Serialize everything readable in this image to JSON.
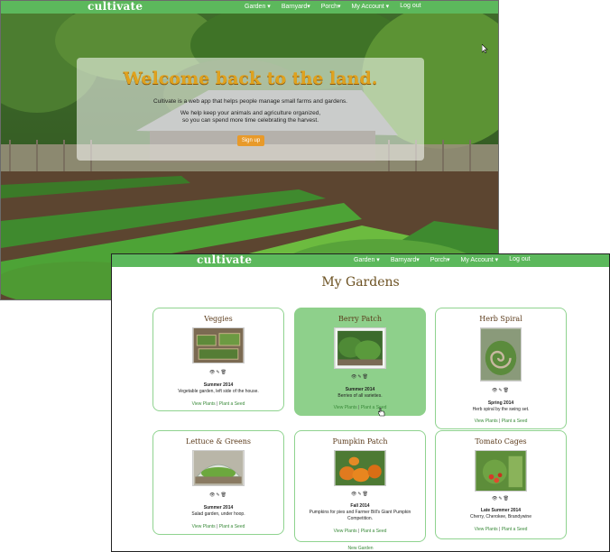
{
  "back": {
    "brand": "cultivate",
    "nav": [
      "Garden ▾",
      "Barnyard▾",
      "Porch▾",
      "My Account ▾",
      "Log out"
    ],
    "hero": {
      "title": "Welcome back to the land.",
      "line1": "Cultivate is a web app that helps people manage small farms and gardens.",
      "line2": "We help keep your animals and agriculture organized,",
      "line3": "so you can spend more time celebrating the harvest.",
      "button": "Sign up"
    }
  },
  "front": {
    "brand": "cultivate",
    "nav": [
      "Garden ▾",
      "Barnyard▾",
      "Porch▾",
      "My Account ▾",
      "Log out"
    ],
    "title": "My Gardens",
    "icons": "👁✎🗑",
    "view_plants": "View Plants",
    "plant_seed": "Plant a Seed",
    "bottom_link": "New Garden",
    "cards": [
      {
        "name": "Veggies",
        "season": "Summer 2014",
        "desc": "Vegetable garden, left side of the house."
      },
      {
        "name": "Berry Patch",
        "season": "Summer 2014",
        "desc": "Berries of all varieties."
      },
      {
        "name": "Herb Spiral",
        "season": "Spring 2014",
        "desc": "Herb spiral by the swing set."
      },
      {
        "name": "Lettuce & Greens",
        "season": "Summer 2014",
        "desc": "Salad garden, under hoop."
      },
      {
        "name": "Pumpkin Patch",
        "season": "Fall 2014",
        "desc": "Pumpkins for pies and Farmer Bill's Giant Pumpkin Competition."
      },
      {
        "name": "Tomato Cages",
        "season": "Late Summer 2014",
        "desc": "Cherry, Cherokee, Brandywine"
      }
    ]
  },
  "colors": {
    "nav_green": "#5cb85c",
    "card_border": "#8fd38f",
    "active_card": "#8ed08b",
    "hero_title": "#e0a21e",
    "signup_button": "#e89a2a",
    "link_green": "#3a8a3a"
  }
}
